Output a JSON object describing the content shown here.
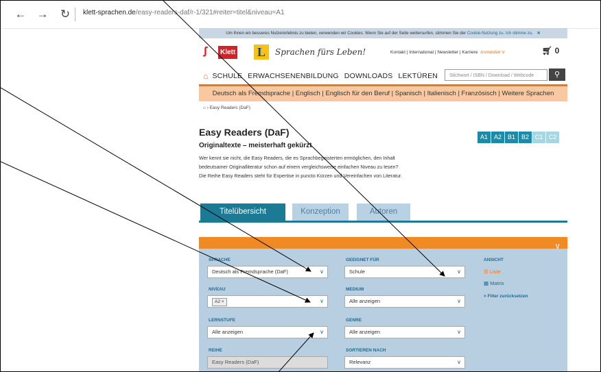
{
  "browser": {
    "address_host": "klett-sprachen.de",
    "address_path": "/easy-readers-daf/r-1/321#reiter=titel&niveau=A1"
  },
  "cookie": {
    "text": "Um Ihnen ein besseres Nutzererlebnis zu bieten, verwenden wir Cookies. Wenn Sie auf der Seite weitersurfen, stimmen Sie der",
    "link": "Cookie-Nutzung zu.",
    "agree": "Ich stimme zu.",
    "close": "✕"
  },
  "header": {
    "klett_logo": "Klett",
    "l_logo": "L",
    "slogan": "Sprachen fürs Leben!",
    "toplinks": "Kontakt | International | Newsletter | Karriere",
    "login": "Anmelden",
    "cart_count": "0",
    "nav": [
      "SCHULE",
      "ERWACHSENENBILDUNG",
      "DOWNLOADS",
      "LEKTÜREN"
    ],
    "search_placeholder": "Stichwort / ISBN / Download / Webcode"
  },
  "languages": "Deutsch als Fremdsprache  |  Englisch  |  Englisch für den Beruf  |  Spanisch  |  Italienisch  |  Französisch  |  Weitere Sprachen",
  "breadcrumb": "Easy Readers (DaF)",
  "page": {
    "title": "Easy Readers (DaF)",
    "subtitle": "Originaltexte – meisterhaft gekürzt",
    "desc1": "Wer kennt sie nicht, die Easy Readers, die es Sprachbegeisterten ermöglichen, den Inhalt",
    "desc2": "bedeutsamer Originalliteratur schon auf einem vergleichsweise einfachen Niveau zu lesen?",
    "desc3": "Die Reihe Easy Readers steht für Expertise in puncto Kürzen und Vereinfachen von Literatur.",
    "levels": [
      "A1",
      "A2",
      "B1",
      "B2",
      "C1",
      "C2"
    ]
  },
  "tabs": [
    "Titelübersicht",
    "Konzeption",
    "Autoren"
  ],
  "filters": {
    "sprache_label": "SPRACHE",
    "sprache_value": "Deutsch als Fremdsprache (DaF)",
    "geeignet_label": "GEEIGNET FÜR",
    "geeignet_value": "Schule",
    "niveau_label": "NIVEAU",
    "niveau_chip": "A2 ×",
    "medium_label": "MEDIUM",
    "medium_value": "Alle anzeigen",
    "lernstufe_label": "LERNSTUFE",
    "lernstufe_value": "Alle anzeigen",
    "genre_label": "GENRE",
    "genre_value": "Alle anzeigen",
    "reihe_label": "REIHE",
    "reihe_value": "Easy Readers (DaF)",
    "sort_label": "SORTIEREN NACH",
    "sort_value": "Relevanz",
    "ansicht_label": "ANSICHT",
    "view_liste": "Liste",
    "view_matrix": "Matrix",
    "reset": "Filter zurücksetzen"
  }
}
